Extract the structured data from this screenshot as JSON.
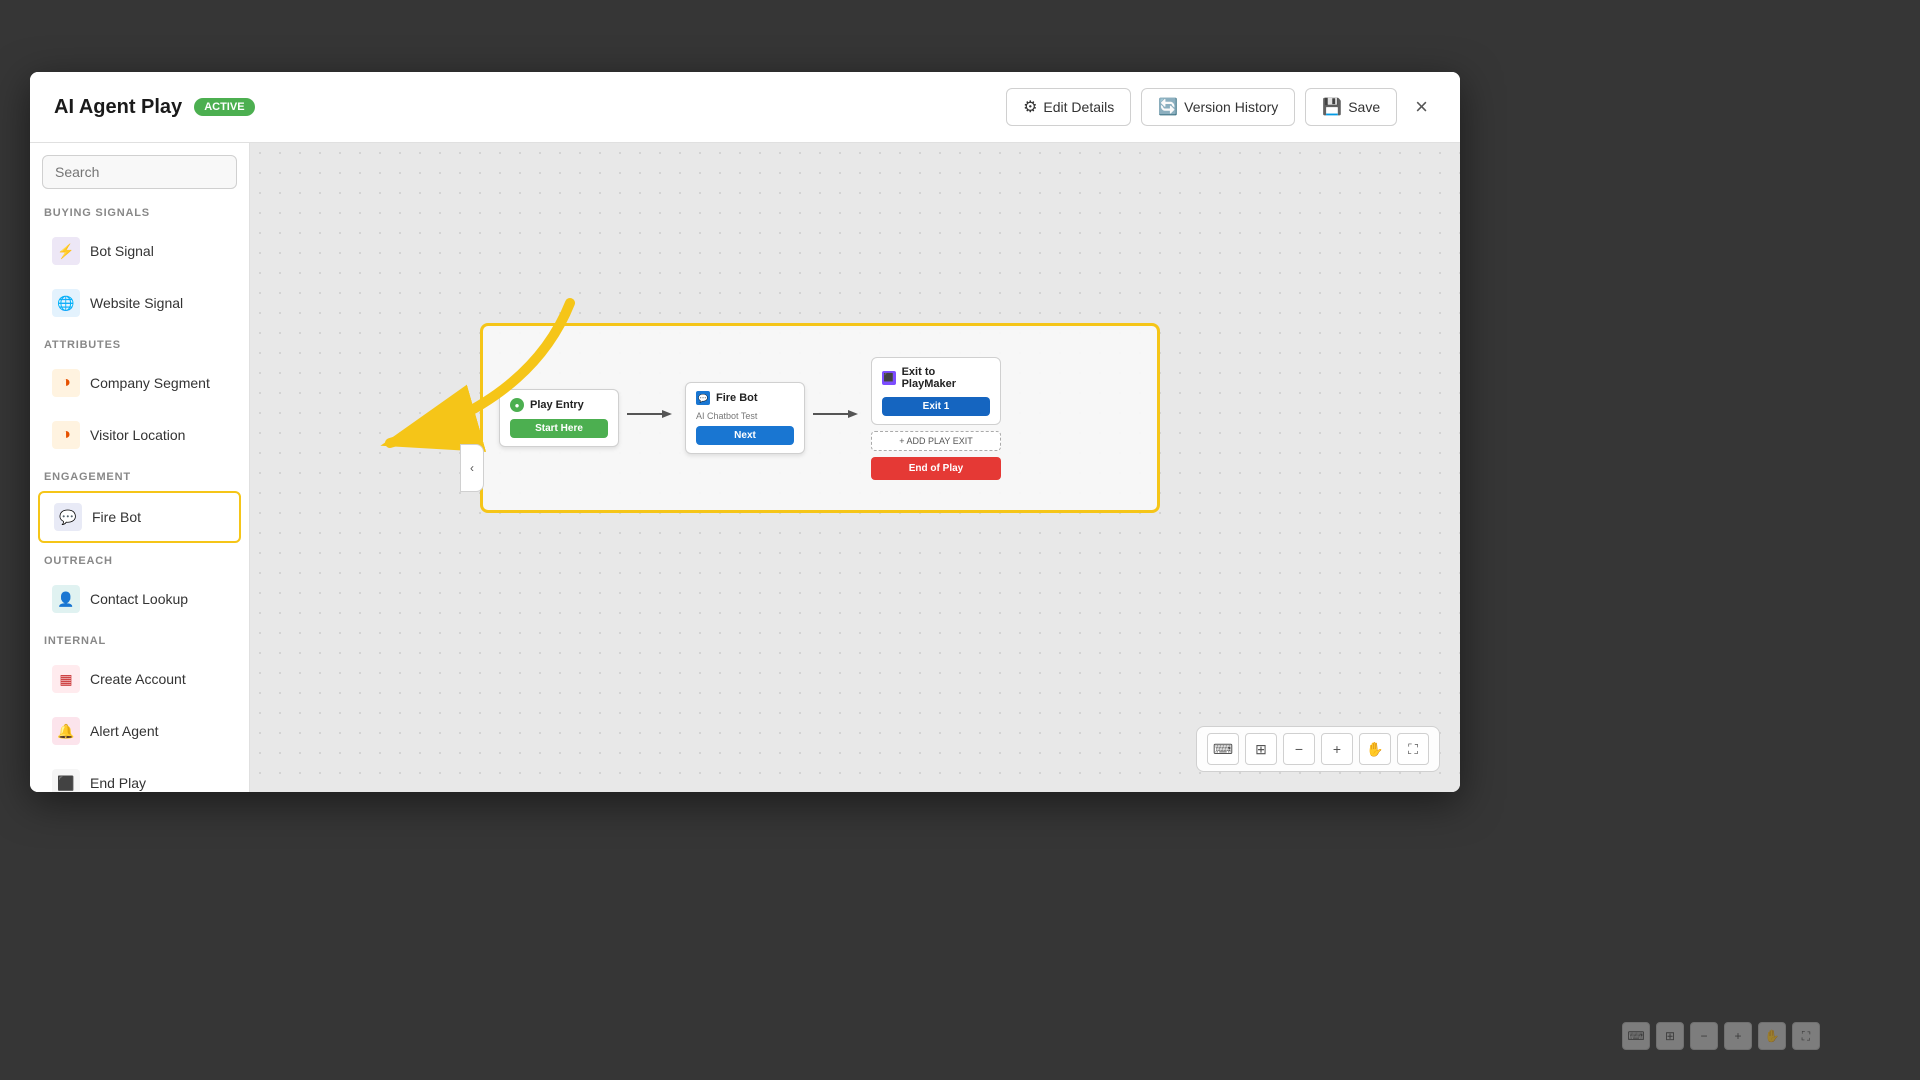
{
  "modal": {
    "title": "AI Agent Play",
    "badge": "Active",
    "close_label": "×"
  },
  "header": {
    "edit_details_label": "Edit Details",
    "version_history_label": "Version History",
    "save_label": "Save"
  },
  "sidebar": {
    "search_placeholder": "Search",
    "sections": [
      {
        "label": "BUYING SIGNALS",
        "items": [
          {
            "id": "bot-signal",
            "label": "Bot Signal",
            "icon": "⚡",
            "icon_class": "icon-purple"
          },
          {
            "id": "website-signal",
            "label": "Website Signal",
            "icon": "🌐",
            "icon_class": "icon-blue"
          }
        ]
      },
      {
        "label": "ATTRIBUTES",
        "items": [
          {
            "id": "company-segment",
            "label": "Company Segment",
            "icon": "◑",
            "icon_class": "icon-orange"
          },
          {
            "id": "visitor-location",
            "label": "Visitor Location",
            "icon": "◑",
            "icon_class": "icon-orange"
          }
        ]
      },
      {
        "label": "ENGAGEMENT",
        "items": [
          {
            "id": "fire-bot",
            "label": "Fire Bot",
            "icon": "💬",
            "icon_class": "icon-indigo",
            "active": true
          }
        ]
      },
      {
        "label": "OUTREACH",
        "items": [
          {
            "id": "contact-lookup",
            "label": "Contact Lookup",
            "icon": "👤",
            "icon_class": "icon-teal"
          }
        ]
      },
      {
        "label": "INTERNAL",
        "items": [
          {
            "id": "create-account",
            "label": "Create Account",
            "icon": "▦",
            "icon_class": "icon-red"
          },
          {
            "id": "alert-agent",
            "label": "Alert Agent",
            "icon": "🔔",
            "icon_class": "icon-pink"
          },
          {
            "id": "end-play",
            "label": "End Play",
            "icon": "⬛",
            "icon_class": "icon-gray"
          }
        ]
      }
    ]
  },
  "flow": {
    "nodes": {
      "entry": {
        "title": "Play Entry",
        "button_label": "Start Here"
      },
      "bot": {
        "title": "Fire Bot",
        "subtitle": "AI Chatbot Test",
        "button_label": "Next"
      },
      "exit": {
        "title": "Exit to PlayMaker",
        "exit1_label": "Exit 1",
        "add_exit_label": "+ ADD PLAY EXIT",
        "end_play_label": "End of Play"
      }
    }
  },
  "canvas_toolbar": {
    "tools": [
      "⌨",
      "⊞",
      "−",
      "+",
      "✋",
      "⛶"
    ]
  }
}
